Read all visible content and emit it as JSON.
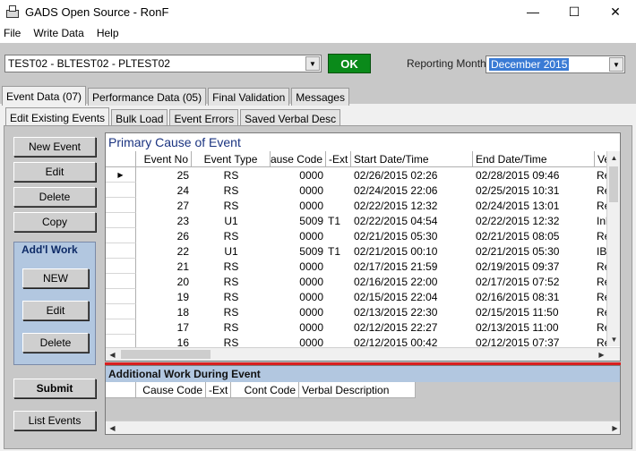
{
  "window": {
    "title": "GADS Open Source - RonF",
    "minimize": "—",
    "maximize": "☐",
    "close": "✕"
  },
  "menu": [
    "File",
    "Write Data",
    "Help"
  ],
  "toolbar": {
    "unit_selector": "TEST02 - BLTEST02 - PLTEST02",
    "ok_label": "OK",
    "reporting_month_label": "Reporting Month",
    "reporting_month_value": "December 2015"
  },
  "main_tabs": [
    "Event Data (07)",
    "Performance Data (05)",
    "Final Validation",
    "Messages"
  ],
  "sub_tabs": [
    "Edit Existing Events",
    "Bulk Load",
    "Event Errors",
    "Saved Verbal Desc"
  ],
  "buttons": {
    "new_event": "New Event",
    "edit": "Edit",
    "delete": "Delete",
    "copy": "Copy",
    "addl_work_title": "Add'l Work",
    "addl_new": "NEW",
    "addl_edit": "Edit",
    "addl_delete": "Delete",
    "submit": "Submit",
    "list_events": "List Events"
  },
  "primary_grid": {
    "caption": "Primary Cause of Event",
    "columns": [
      "Event No",
      "Event Type",
      "Cause Code",
      "-Ext",
      "Start Date/Time",
      "End Date/Time",
      "Ve"
    ],
    "rows": [
      [
        "25",
        "RS",
        "0000",
        "",
        "02/26/2015 02:26",
        "02/28/2015 09:46",
        "Re"
      ],
      [
        "24",
        "RS",
        "0000",
        "",
        "02/24/2015 22:06",
        "02/25/2015 10:31",
        "Re"
      ],
      [
        "27",
        "RS",
        "0000",
        "",
        "02/22/2015 12:32",
        "02/24/2015 13:01",
        "Re"
      ],
      [
        "23",
        "U1",
        "5009",
        "T1",
        "02/22/2015 04:54",
        "02/22/2015 12:32",
        "Inl"
      ],
      [
        "26",
        "RS",
        "0000",
        "",
        "02/21/2015 05:30",
        "02/21/2015 08:05",
        "Re"
      ],
      [
        "22",
        "U1",
        "5009",
        "T1",
        "02/21/2015 00:10",
        "02/21/2015 05:30",
        "IBI"
      ],
      [
        "21",
        "RS",
        "0000",
        "",
        "02/17/2015 21:59",
        "02/19/2015 09:37",
        "Re"
      ],
      [
        "20",
        "RS",
        "0000",
        "",
        "02/16/2015 22:00",
        "02/17/2015 07:52",
        "Re"
      ],
      [
        "19",
        "RS",
        "0000",
        "",
        "02/15/2015 22:04",
        "02/16/2015 08:31",
        "Re"
      ],
      [
        "18",
        "RS",
        "0000",
        "",
        "02/13/2015 22:30",
        "02/15/2015 11:50",
        "Re"
      ],
      [
        "17",
        "RS",
        "0000",
        "",
        "02/12/2015 22:27",
        "02/13/2015 11:00",
        "Re"
      ],
      [
        "16",
        "RS",
        "0000",
        "",
        "02/12/2015 00:42",
        "02/12/2015 07:37",
        "Re"
      ]
    ]
  },
  "addl_grid": {
    "caption": "Additional Work During Event",
    "columns": [
      "Cause Code",
      "-Ext",
      "Cont Code",
      "Verbal Description"
    ]
  }
}
